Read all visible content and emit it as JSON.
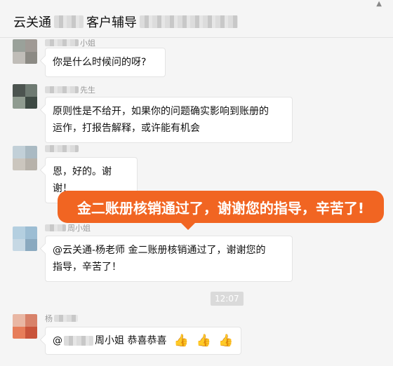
{
  "window": {
    "title_prefix": "云关通",
    "title_mid": "客户辅导"
  },
  "messages": [
    {
      "sender_suffix": "小姐",
      "text": "你是什么时候问的呀?"
    },
    {
      "sender_suffix": "先生",
      "text_line1": "原则性是不给开，如果你的问题确实影响到账册的",
      "text_line2": "运作，打报告解释，或许能有机会"
    },
    {
      "sender_suffix": "",
      "text": "恩，好的。谢谢！"
    },
    {
      "sender_suffix": "周小姐",
      "text_line1": "@云关通-杨老师 金二账册核销通过了，谢谢您的",
      "text_line2": "指导，辛苦了！"
    },
    {
      "sender_prefix": "杨",
      "text_prefix": "@",
      "text_after": "周小姐 恭喜恭喜"
    }
  ],
  "callout": {
    "text": "金二账册核销通过了，谢谢您的指导，辛苦了!"
  },
  "timestamp": "12:07",
  "colors": {
    "accent": "#f16522",
    "background": "#f5f5f5"
  },
  "icons": {
    "thumbs": [
      "thumbs-up-icon",
      "thumbs-up-icon",
      "thumbs-up-icon"
    ]
  }
}
